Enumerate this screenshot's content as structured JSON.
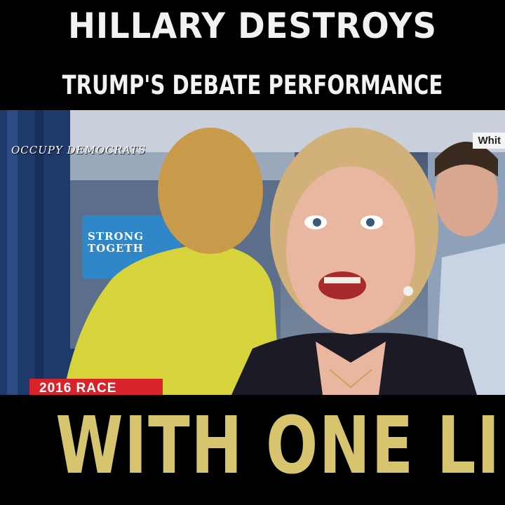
{
  "headline": {
    "line1": "HILLARY DESTROYS",
    "line2": "TRUMP'S DEBATE PERFORMANCE",
    "line3": "WITH ONE LINE"
  },
  "photo": {
    "watermark": "OCCUPY DEMOCRATS",
    "corner_tag": "Whit",
    "sign_text": "STRONG TOGETHER",
    "race_badge": "2016 RACE"
  },
  "colors": {
    "headline_top": "#f2f2f2",
    "headline_bottom": "#d7c46e",
    "badge_red": "#d9232a",
    "sign_blue": "#2f86c8",
    "jacket_yellow": "#d6d43a"
  }
}
